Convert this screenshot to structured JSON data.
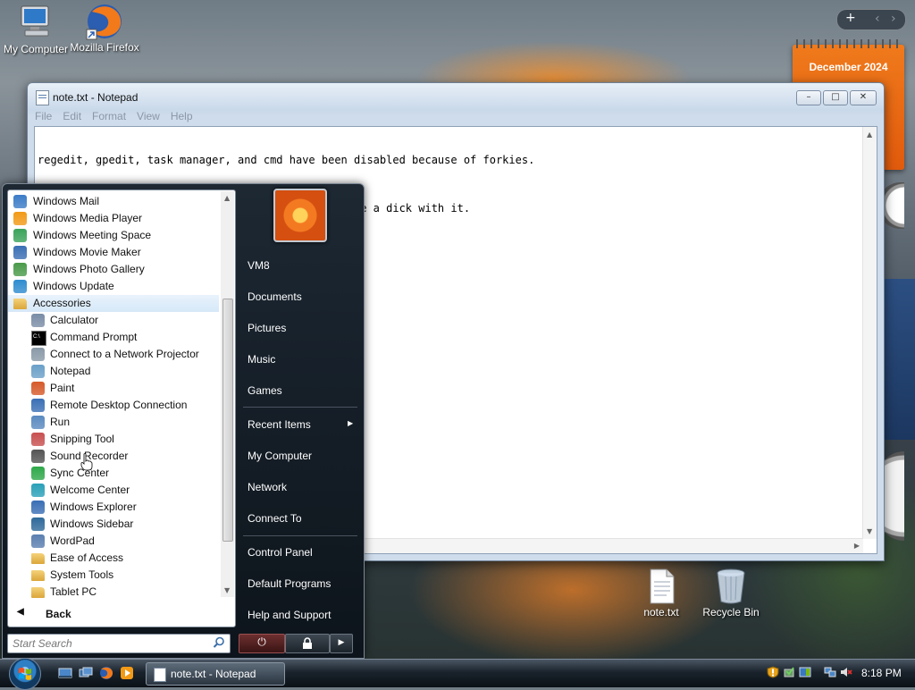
{
  "desktop": {
    "icons": [
      {
        "label": "My Computer"
      },
      {
        "label": "Mozilla Firefox"
      },
      {
        "label": "note.txt"
      },
      {
        "label": "Recycle Bin"
      }
    ]
  },
  "gadgets": {
    "calendar_month": "December 2024",
    "nav_add": "+",
    "nav_prev": "‹",
    "nav_next": "›"
  },
  "notepad": {
    "title": "note.txt - Notepad",
    "menu": [
      "File",
      "Edit",
      "Format",
      "View",
      "Help"
    ],
    "lines": [
      "regedit, gpedit, task manager, and cmd have been disabled because of forkies.",
      "There's also only 600MB of storage left so don't be a dick with it."
    ],
    "controls": {
      "minimize": "–",
      "maximize": "□",
      "close": "✕"
    }
  },
  "start_menu": {
    "programs": [
      {
        "label": "Windows Mail",
        "level": 0,
        "icon": "mail-icon",
        "color": "#3b7cc7"
      },
      {
        "label": "Windows Media Player",
        "level": 0,
        "icon": "media-player-icon",
        "color": "#f29a16"
      },
      {
        "label": "Windows Meeting Space",
        "level": 0,
        "icon": "meeting-space-icon",
        "color": "#3aa35a"
      },
      {
        "label": "Windows Movie Maker",
        "level": 0,
        "icon": "movie-maker-icon",
        "color": "#3a6fb5"
      },
      {
        "label": "Windows Photo Gallery",
        "level": 0,
        "icon": "photo-gallery-icon",
        "color": "#4a9a4a"
      },
      {
        "label": "Windows Update",
        "level": 0,
        "icon": "update-icon",
        "color": "#2f8ccf"
      },
      {
        "label": "Accessories",
        "level": 0,
        "icon": "folder-icon",
        "color": "#e0b04a",
        "selected": true
      },
      {
        "label": "Calculator",
        "level": 1,
        "icon": "calculator-icon",
        "color": "#7a8da6"
      },
      {
        "label": "Command Prompt",
        "level": 1,
        "icon": "command-prompt-icon",
        "color": "#000000"
      },
      {
        "label": "Connect to a Network Projector",
        "level": 1,
        "icon": "network-projector-icon",
        "color": "#8a9aa8"
      },
      {
        "label": "Notepad",
        "level": 1,
        "icon": "notepad-icon",
        "color": "#6aa0c8"
      },
      {
        "label": "Paint",
        "level": 1,
        "icon": "paint-icon",
        "color": "#d65a2a"
      },
      {
        "label": "Remote Desktop Connection",
        "level": 1,
        "icon": "remote-desktop-icon",
        "color": "#3a6fb5"
      },
      {
        "label": "Run",
        "level": 1,
        "icon": "run-icon",
        "color": "#5a8ac0"
      },
      {
        "label": "Snipping Tool",
        "level": 1,
        "icon": "snipping-tool-icon",
        "color": "#c85050"
      },
      {
        "label": "Sound Recorder",
        "level": 1,
        "icon": "microphone-icon",
        "color": "#555555"
      },
      {
        "label": "Sync Center",
        "level": 1,
        "icon": "sync-center-icon",
        "color": "#2fa84a"
      },
      {
        "label": "Welcome Center",
        "level": 1,
        "icon": "welcome-center-icon",
        "color": "#2aa0b8"
      },
      {
        "label": "Windows Explorer",
        "level": 1,
        "icon": "explorer-icon",
        "color": "#3a6fb5"
      },
      {
        "label": "Windows Sidebar",
        "level": 1,
        "icon": "sidebar-icon",
        "color": "#2f6a9a"
      },
      {
        "label": "WordPad",
        "level": 1,
        "icon": "wordpad-icon",
        "color": "#5a7fb0"
      },
      {
        "label": "Ease of Access",
        "level": 1,
        "icon": "folder-icon",
        "color": "#e0b04a"
      },
      {
        "label": "System Tools",
        "level": 1,
        "icon": "folder-icon",
        "color": "#e0b04a"
      },
      {
        "label": "Tablet PC",
        "level": 1,
        "icon": "folder-icon",
        "color": "#e0b04a"
      }
    ],
    "back_label": "Back",
    "search_placeholder": "Start Search",
    "right_items": [
      {
        "label": "VM8"
      },
      {
        "label": "Documents"
      },
      {
        "label": "Pictures"
      },
      {
        "label": "Music"
      },
      {
        "label": "Games"
      },
      {
        "label": "Recent Items"
      },
      {
        "label": "My Computer"
      },
      {
        "label": "Network"
      },
      {
        "label": "Connect To"
      },
      {
        "label": "Control Panel"
      },
      {
        "label": "Default Programs"
      },
      {
        "label": "Help and Support"
      }
    ],
    "power_symbol": "⏻",
    "lock_symbol": "🔒",
    "more_symbol": "▶"
  },
  "taskbar": {
    "task_label": "note.txt - Notepad",
    "clock": "8:18 PM"
  }
}
